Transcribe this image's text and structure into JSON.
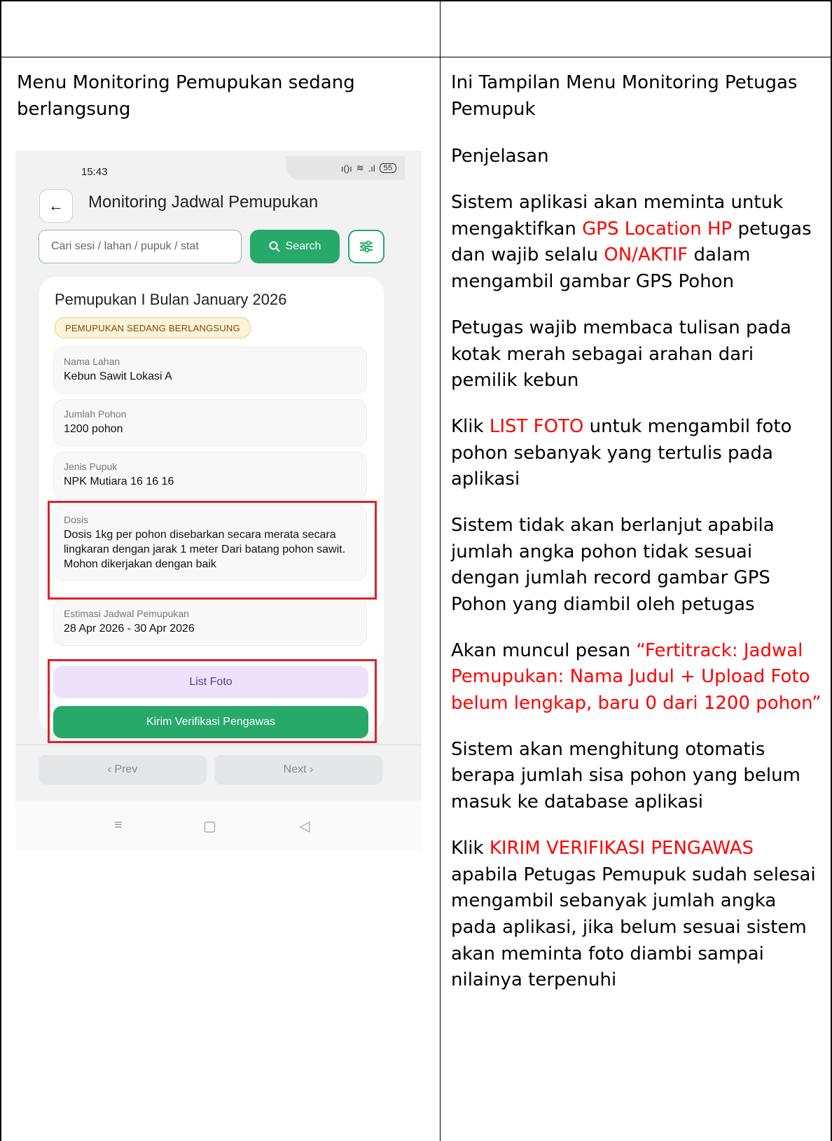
{
  "left": {
    "title": "Menu Monitoring Pemupukan sedang berlangsung"
  },
  "phone": {
    "time": "15:43",
    "battery": "55",
    "title": "Monitoring Jadwal Pemupukan",
    "search_placeholder": "Cari sesi / lahan / pupuk / stat",
    "search_label": "Search",
    "card_title": "Pemupukan I Bulan January 2026",
    "badge": "PEMUPUKAN SEDANG BERLANGSUNG",
    "fields": [
      {
        "label": "Nama Lahan",
        "value": "Kebun Sawit Lokasi A"
      },
      {
        "label": "Jumlah Pohon",
        "value": "1200 pohon"
      },
      {
        "label": "Jenis Pupuk",
        "value": "NPK Mutiara 16 16 16"
      },
      {
        "label": "Dosis",
        "value": "Dosis 1kg per pohon disebarkan secara merata secara lingkaran dengan jarak 1 meter Dari batang pohon sawit. Mohon dikerjakan dengan baik"
      },
      {
        "label": "Estimasi Jadwal Pemupukan",
        "value": "28 Apr 2026 - 30 Apr 2026"
      }
    ],
    "list_foto": "List Foto",
    "kirim": "Kirim Verifikasi Pengawas",
    "prev": "‹  Prev",
    "next": "Next  ›"
  },
  "right": {
    "title": "Ini Tampilan Menu Monitoring Petugas Pemupuk",
    "subtitle": "Penjelasan",
    "p1_a": "Sistem aplikasi akan meminta untuk mengaktifkan ",
    "p1_b": "GPS Location HP",
    "p1_c": " petugas dan wajib selalu ",
    "p1_d": "ON/AKTIF",
    "p1_e": " dalam mengambil gambar GPS Pohon",
    "p2": "Petugas wajib membaca tulisan pada kotak merah sebagai arahan dari pemilik kebun",
    "p3_a": "Klik ",
    "p3_b": "LIST FOTO",
    "p3_c": " untuk mengambil foto pohon sebanyak yang tertulis pada aplikasi",
    "p4": "Sistem tidak akan berlanjut apabila jumlah angka pohon tidak sesuai dengan jumlah record gambar GPS Pohon yang diambil oleh petugas",
    "p5_a": "Akan muncul pesan ",
    "p5_b": "“Fertitrack: Jadwal Pemupukan: Nama Judul + Upload Foto belum lengkap, baru 0 dari 1200 pohon”",
    "p6": "Sistem akan menghitung otomatis berapa jumlah sisa pohon yang belum masuk ke database aplikasi",
    "p7_a": "Klik ",
    "p7_b": "KIRIM VERIFIKASI PENGAWAS",
    "p7_c": " apabila Petugas Pemupuk sudah selesai mengambil sebanyak jumlah angka pada aplikasi, jika belum sesuai sistem akan meminta foto diambi sampai nilainya terpenuhi"
  }
}
